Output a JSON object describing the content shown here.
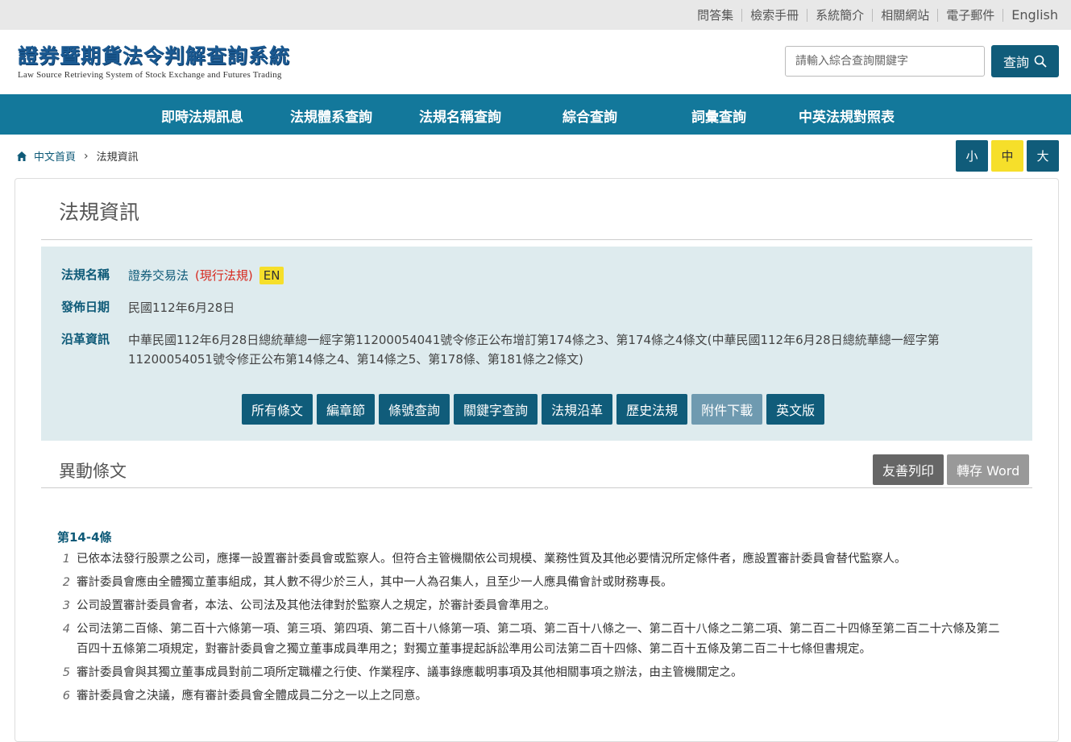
{
  "topbar": {
    "links": [
      "問答集",
      "檢索手冊",
      "系統簡介",
      "相關網站",
      "電子郵件",
      "English"
    ]
  },
  "header": {
    "title": "證券暨期貨法令判解查詢系統",
    "subtitle": "Law Source Retrieving System of Stock Exchange and Futures Trading",
    "search_placeholder": "請輸入綜合查詢關鍵字",
    "search_button": "查詢"
  },
  "nav": {
    "items": [
      "即時法規訊息",
      "法規體系查詢",
      "法規名稱查詢",
      "綜合查詢",
      "詞彙查詢",
      "中英法規對照表"
    ]
  },
  "breadcrumb": {
    "home": "中文首頁",
    "current": "法規資訊"
  },
  "font_size": {
    "small": "小",
    "medium": "中",
    "large": "大",
    "active": "中"
  },
  "page": {
    "title": "法規資訊"
  },
  "law_info": {
    "name_label": "法規名稱",
    "name": "證券交易法",
    "status": "(現行法規)",
    "en_badge": "EN",
    "date_label": "發佈日期",
    "date": "民國112年6月28日",
    "history_label": "沿革資訊",
    "history": "中華民國112年6月28日總統華總一經字第11200054041號令修正公布增訂第174條之3、第174條之4條文(中華民國112年6月28日總統華總一經字第11200054051號令修正公布第14條之4、第14條之5、第178條、第181條之2條文)"
  },
  "tabs": {
    "all_articles": "所有條文",
    "chapters": "編章節",
    "article_search": "條號查詢",
    "keyword_search": "關鍵字查詢",
    "history": "法規沿革",
    "past_versions": "歷史法規",
    "attachments": "附件下載",
    "english": "英文版"
  },
  "section": {
    "title": "異動條文",
    "print": "友善列印",
    "word": "轉存 Word"
  },
  "article": {
    "number": "第14-4條",
    "clauses": [
      {
        "no": "1",
        "text": "已依本法發行股票之公司，應擇一設置審計委員會或監察人。但符合主管機關依公司規模、業務性質及其他必要情況所定條件者，應設置審計委員會替代監察人。"
      },
      {
        "no": "2",
        "text": "審計委員會應由全體獨立董事組成，其人數不得少於三人，其中一人為召集人，且至少一人應具備會計或財務專長。"
      },
      {
        "no": "3",
        "text": "公司設置審計委員會者，本法、公司法及其他法律對於監察人之規定，於審計委員會準用之。"
      },
      {
        "no": "4",
        "text": "公司法第二百條、第二百十六條第一項、第三項、第四項、第二百十八條第一項、第二項、第二百十八條之一、第二百十八條之二第二項、第二百二十四條至第二百二十六條及第二百四十五條第二項規定，對審計委員會之獨立董事成員準用之；對獨立董事提起訴訟準用公司法第二百十四條、第二百十五條及第二百二十七條但書規定。"
      },
      {
        "no": "5",
        "text": "審計委員會與其獨立董事成員對前二項所定職權之行使、作業程序、議事錄應載明事項及其他相關事項之辦法，由主管機關定之。"
      },
      {
        "no": "6",
        "text": "審計委員會之決議，應有審計委員會全體成員二分之一以上之同意。"
      }
    ]
  }
}
